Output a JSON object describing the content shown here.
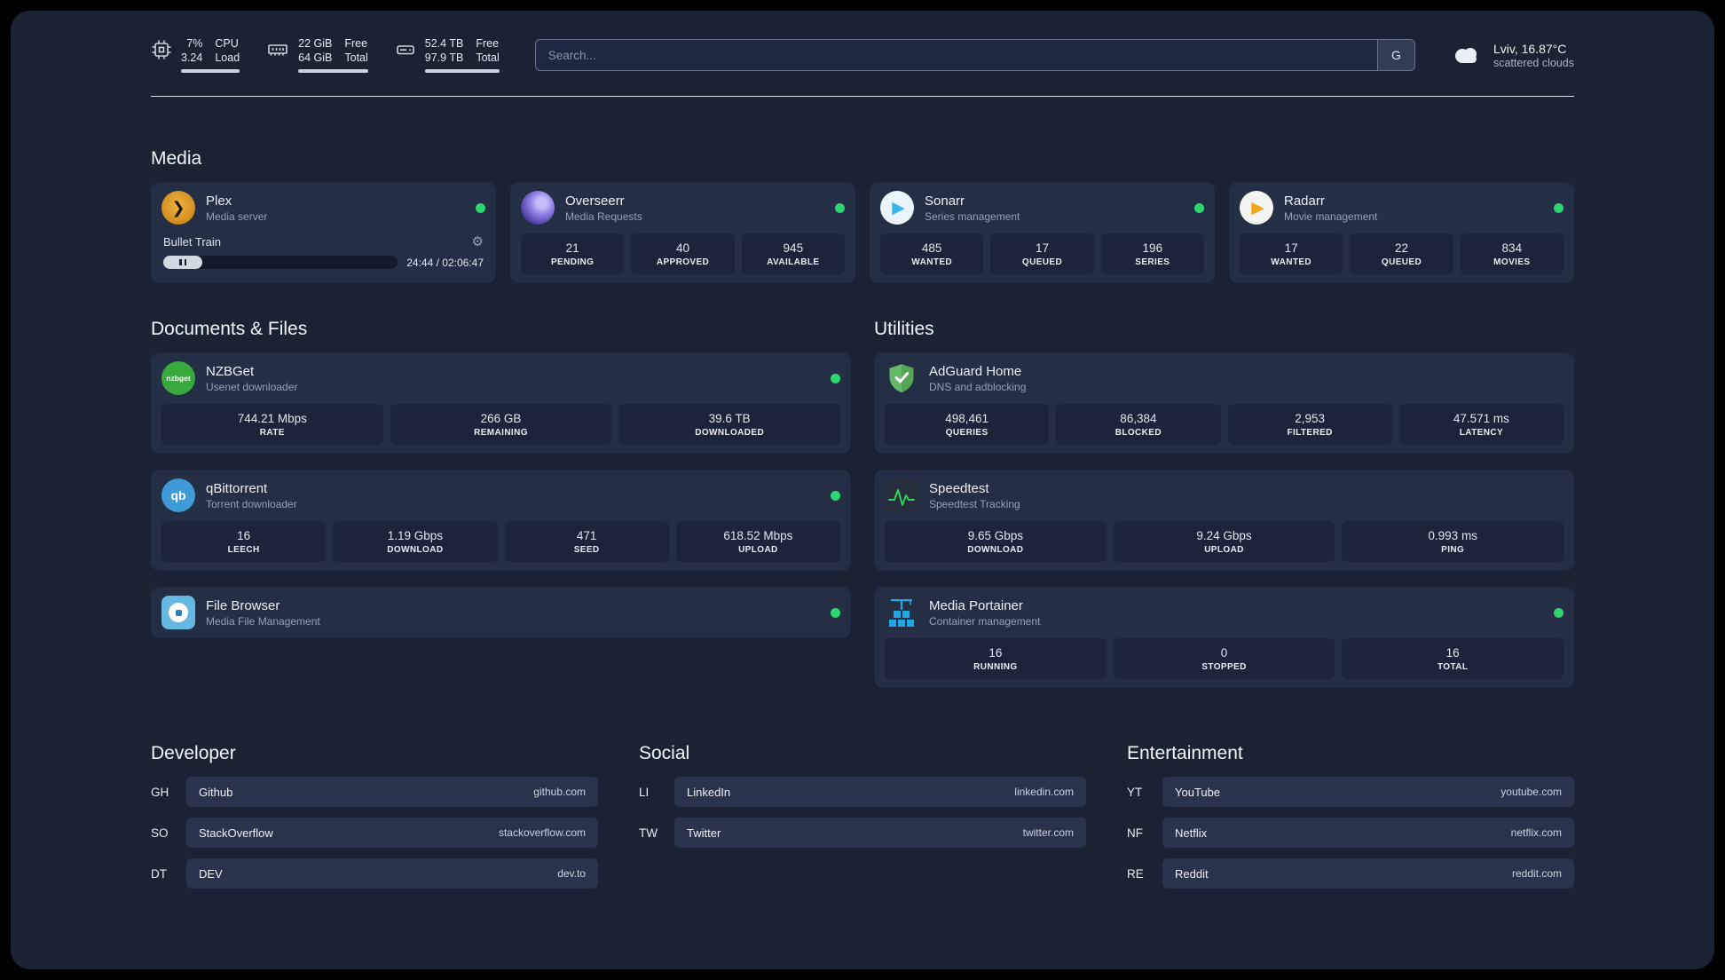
{
  "header": {
    "cpu": {
      "percent": "7%",
      "load": "3.24",
      "label1": "CPU",
      "label2": "Load"
    },
    "ram": {
      "free": "22 GiB",
      "total": "64 GiB",
      "label1": "Free",
      "label2": "Total"
    },
    "disk": {
      "free": "52.4 TB",
      "total": "97.9 TB",
      "label1": "Free",
      "label2": "Total"
    },
    "search": {
      "placeholder": "Search...",
      "engine_label": "G"
    },
    "weather": {
      "location": "Lviv, 16.87°C",
      "condition": "scattered clouds"
    }
  },
  "sections": {
    "media": "Media",
    "documents": "Documents & Files",
    "utilities": "Utilities",
    "developer": "Developer",
    "social": "Social",
    "entertainment": "Entertainment"
  },
  "media": {
    "plex": {
      "name": "Plex",
      "subtitle": "Media server",
      "icon_glyph": "❯",
      "now_playing": "Bullet Train",
      "time": "24:44 / 02:06:47"
    },
    "overseerr": {
      "name": "Overseerr",
      "subtitle": "Media Requests",
      "stats": [
        {
          "value": "21",
          "label": "PENDING"
        },
        {
          "value": "40",
          "label": "APPROVED"
        },
        {
          "value": "945",
          "label": "AVAILABLE"
        }
      ]
    },
    "sonarr": {
      "name": "Sonarr",
      "subtitle": "Series management",
      "icon_glyph": "▶",
      "stats": [
        {
          "value": "485",
          "label": "WANTED"
        },
        {
          "value": "17",
          "label": "QUEUED"
        },
        {
          "value": "196",
          "label": "SERIES"
        }
      ]
    },
    "radarr": {
      "name": "Radarr",
      "subtitle": "Movie management",
      "icon_glyph": "▶",
      "stats": [
        {
          "value": "17",
          "label": "WANTED"
        },
        {
          "value": "22",
          "label": "QUEUED"
        },
        {
          "value": "834",
          "label": "MOVIES"
        }
      ]
    }
  },
  "documents": {
    "nzbget": {
      "name": "NZBGet",
      "subtitle": "Usenet downloader",
      "icon_label": "nzbget",
      "stats": [
        {
          "value": "744.21 Mbps",
          "label": "RATE"
        },
        {
          "value": "266 GB",
          "label": "REMAINING"
        },
        {
          "value": "39.6 TB",
          "label": "DOWNLOADED"
        }
      ]
    },
    "qbittorrent": {
      "name": "qBittorrent",
      "subtitle": "Torrent downloader",
      "icon_label": "qb",
      "stats": [
        {
          "value": "16",
          "label": "LEECH"
        },
        {
          "value": "1.19 Gbps",
          "label": "DOWNLOAD"
        },
        {
          "value": "471",
          "label": "SEED"
        },
        {
          "value": "618.52 Mbps",
          "label": "UPLOAD"
        }
      ]
    },
    "filebrowser": {
      "name": "File Browser",
      "subtitle": "Media File Management"
    }
  },
  "utilities": {
    "adguard": {
      "name": "AdGuard Home",
      "subtitle": "DNS and adblocking",
      "stats": [
        {
          "value": "498,461",
          "label": "QUERIES"
        },
        {
          "value": "86,384",
          "label": "BLOCKED"
        },
        {
          "value": "2,953",
          "label": "FILTERED"
        },
        {
          "value": "47.571 ms",
          "label": "LATENCY"
        }
      ]
    },
    "speedtest": {
      "name": "Speedtest",
      "subtitle": "Speedtest Tracking",
      "stats": [
        {
          "value": "9.65 Gbps",
          "label": "DOWNLOAD"
        },
        {
          "value": "9.24 Gbps",
          "label": "UPLOAD"
        },
        {
          "value": "0.993 ms",
          "label": "PING"
        }
      ]
    },
    "portainer": {
      "name": "Media Portainer",
      "subtitle": "Container management",
      "stats": [
        {
          "value": "16",
          "label": "RUNNING"
        },
        {
          "value": "0",
          "label": "STOPPED"
        },
        {
          "value": "16",
          "label": "TOTAL"
        }
      ]
    }
  },
  "links": {
    "developer": [
      {
        "tag": "GH",
        "name": "Github",
        "url": "github.com"
      },
      {
        "tag": "SO",
        "name": "StackOverflow",
        "url": "stackoverflow.com"
      },
      {
        "tag": "DT",
        "name": "DEV",
        "url": "dev.to"
      }
    ],
    "social": [
      {
        "tag": "LI",
        "name": "LinkedIn",
        "url": "linkedin.com"
      },
      {
        "tag": "TW",
        "name": "Twitter",
        "url": "twitter.com"
      }
    ],
    "entertainment": [
      {
        "tag": "YT",
        "name": "YouTube",
        "url": "youtube.com"
      },
      {
        "tag": "NF",
        "name": "Netflix",
        "url": "netflix.com"
      },
      {
        "tag": "RE",
        "name": "Reddit",
        "url": "reddit.com"
      }
    ]
  },
  "colors": {
    "background": "#1a2234",
    "card": "#242e45",
    "tile": "#1b2438",
    "status_online": "#2ed573"
  }
}
